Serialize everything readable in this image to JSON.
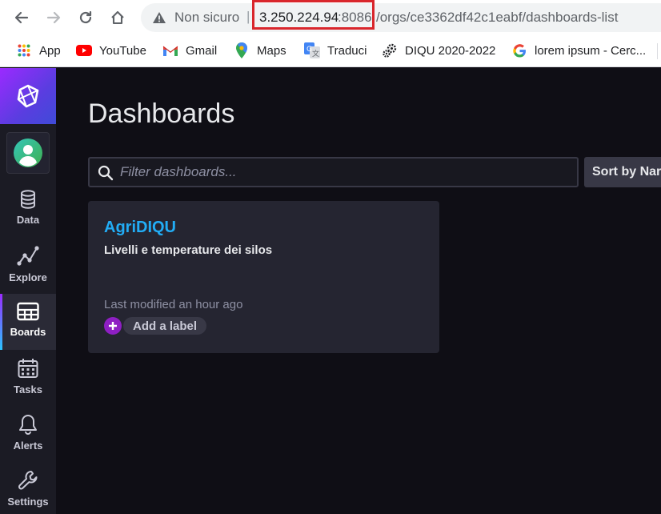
{
  "browser": {
    "security_label": "Non sicuro",
    "separator": "|",
    "url_host": "3.250.224.94",
    "url_port": ":8086",
    "url_path": "/orgs/ce3362df42c1eabf/dashboards-list",
    "highlight_color": "#d9262c"
  },
  "bookmarks": [
    {
      "label": "App",
      "icon": "apps-grid-icon"
    },
    {
      "label": "YouTube",
      "icon": "youtube-icon"
    },
    {
      "label": "Gmail",
      "icon": "gmail-icon"
    },
    {
      "label": "Maps",
      "icon": "maps-pin-icon"
    },
    {
      "label": "Traduci",
      "icon": "translate-icon"
    },
    {
      "label": "DIQU 2020-2022",
      "icon": "gears-icon"
    },
    {
      "label": "lorem ipsum - Cerc...",
      "icon": "google-icon"
    }
  ],
  "sidebar": {
    "items": [
      {
        "label": "Data",
        "icon": "database-icon"
      },
      {
        "label": "Explore",
        "icon": "graph-icon"
      },
      {
        "label": "Boards",
        "icon": "dashboard-icon",
        "active": true
      },
      {
        "label": "Tasks",
        "icon": "calendar-icon"
      },
      {
        "label": "Alerts",
        "icon": "bell-icon"
      },
      {
        "label": "Settings",
        "icon": "wrench-icon"
      }
    ]
  },
  "main": {
    "title": "Dashboards",
    "filter_placeholder": "Filter dashboards...",
    "sort_label": "Sort by Nar"
  },
  "dashboards": [
    {
      "name": "AgriDIQU",
      "description": "Livelli e temperature dei silos",
      "modified": "Last modified an hour ago",
      "add_label": "Add a label"
    }
  ],
  "colors": {
    "accent_blue": "#22adf6",
    "accent_purple": "#8e1fc3",
    "background": "#0f0e15",
    "card": "#252531"
  }
}
